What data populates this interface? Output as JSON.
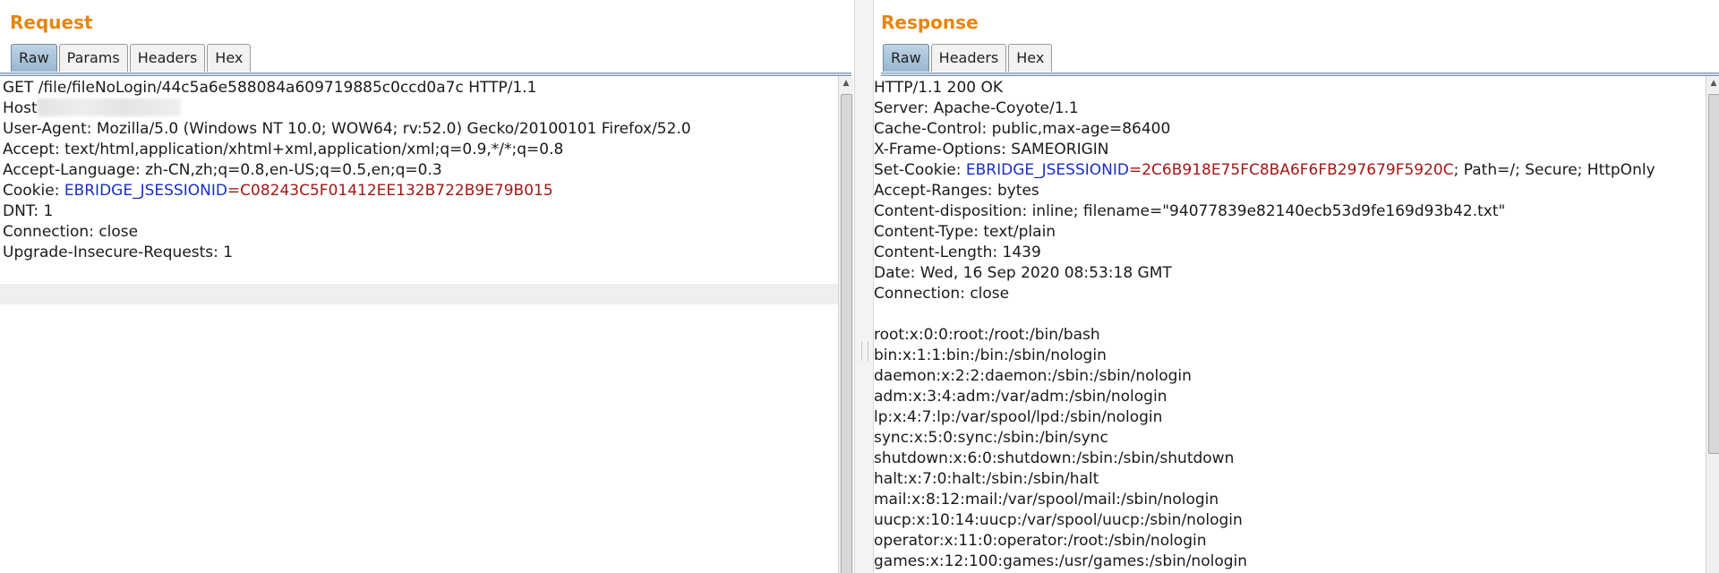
{
  "request": {
    "title": "Request",
    "tabs": [
      "Raw",
      "Params",
      "Headers",
      "Hex"
    ],
    "active_tab": "Raw",
    "lines": {
      "request_line": "GET /file/fileNoLogin/44c5a6e588084a609719885c0ccd0a7c HTTP/1.1",
      "host_label": "Host",
      "user_agent": "User-Agent: Mozilla/5.0 (Windows NT 10.0; WOW64; rv:52.0) Gecko/20100101 Firefox/52.0",
      "accept": "Accept: text/html,application/xhtml+xml,application/xml;q=0.9,*/*;q=0.8",
      "accept_language": "Accept-Language: zh-CN,zh;q=0.8,en-US;q=0.5,en;q=0.3",
      "cookie_prefix": "Cookie: ",
      "cookie_name": "EBRIDGE_JSESSIONID",
      "cookie_eq": "=",
      "cookie_value": "C08243C5F01412EE132B722B9E79B015",
      "dnt": "DNT: 1",
      "connection": "Connection: close",
      "upgrade": "Upgrade-Insecure-Requests: 1"
    }
  },
  "response": {
    "title": "Response",
    "tabs": [
      "Raw",
      "Headers",
      "Hex"
    ],
    "active_tab": "Raw",
    "lines": {
      "status": "HTTP/1.1 200 OK",
      "server": "Server: Apache-Coyote/1.1",
      "cache_control": "Cache-Control: public,max-age=86400",
      "x_frame": "X-Frame-Options: SAMEORIGIN",
      "set_cookie_prefix": "Set-Cookie: ",
      "set_cookie_name": "EBRIDGE_JSESSIONID",
      "set_cookie_eq": "=",
      "set_cookie_value": "2C6B918E75FC8BA6F6FB297679F5920C",
      "set_cookie_suffix": "; Path=/; Secure; HttpOnly",
      "accept_ranges": "Accept-Ranges: bytes",
      "content_disposition": "Content-disposition: inline; filename=\"94077839e82140ecb53d9fe169d93b42.txt\"",
      "content_type": "Content-Type: text/plain",
      "content_length": "Content-Length: 1439",
      "date": "Date: Wed, 16 Sep 2020 08:53:18 GMT",
      "connection": "Connection: close"
    },
    "body_lines": [
      "root:x:0:0:root:/root:/bin/bash",
      "bin:x:1:1:bin:/bin:/sbin/nologin",
      "daemon:x:2:2:daemon:/sbin:/sbin/nologin",
      "adm:x:3:4:adm:/var/adm:/sbin/nologin",
      "lp:x:4:7:lp:/var/spool/lpd:/sbin/nologin",
      "sync:x:5:0:sync:/sbin:/bin/sync",
      "shutdown:x:6:0:shutdown:/sbin:/sbin/shutdown",
      "halt:x:7:0:halt:/sbin:/sbin/halt",
      "mail:x:8:12:mail:/var/spool/mail:/sbin/nologin",
      "uucp:x:10:14:uucp:/var/spool/uucp:/sbin/nologin",
      "operator:x:11:0:operator:/root:/sbin/nologin",
      "games:x:12:100:games:/usr/games:/sbin/nologin"
    ]
  },
  "icons": {
    "scroll_up": "scroll-up-arrow-icon",
    "scroll_down": "scroll-down-arrow-icon",
    "splitter_grip": "splitter-grip-icon"
  },
  "colors": {
    "title": "#e8850c",
    "header_name": "#1a2fc0",
    "header_value": "#a01818",
    "active_tab": "#a9c3da"
  }
}
